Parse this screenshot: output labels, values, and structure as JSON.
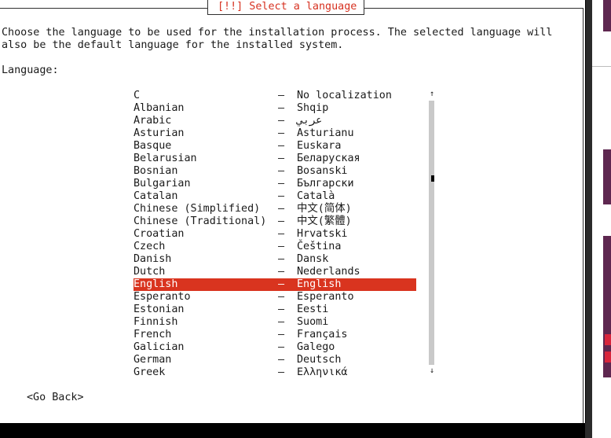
{
  "dialog": {
    "title": "[!!] Select a language",
    "description_line1": "Choose the language to be used for the installation process. The selected language will",
    "description_line2": "also be the default language for the installed system.",
    "list_label": "Language:",
    "go_back_label": "<Go Back>"
  },
  "languages": [
    {
      "name": "C",
      "native": "No localization"
    },
    {
      "name": "Albanian",
      "native": "Shqip"
    },
    {
      "name": "Arabic",
      "native": "عربي"
    },
    {
      "name": "Asturian",
      "native": "Asturianu"
    },
    {
      "name": "Basque",
      "native": "Euskara"
    },
    {
      "name": "Belarusian",
      "native": "Беларуская"
    },
    {
      "name": "Bosnian",
      "native": "Bosanski"
    },
    {
      "name": "Bulgarian",
      "native": "Български"
    },
    {
      "name": "Catalan",
      "native": "Català"
    },
    {
      "name": "Chinese (Simplified)",
      "native": "中文(简体)"
    },
    {
      "name": "Chinese (Traditional)",
      "native": "中文(繁體)"
    },
    {
      "name": "Croatian",
      "native": "Hrvatski"
    },
    {
      "name": "Czech",
      "native": "Čeština"
    },
    {
      "name": "Danish",
      "native": "Dansk"
    },
    {
      "name": "Dutch",
      "native": "Nederlands"
    },
    {
      "name": "English",
      "native": "English",
      "selected": true
    },
    {
      "name": "Esperanto",
      "native": "Esperanto"
    },
    {
      "name": "Estonian",
      "native": "Eesti"
    },
    {
      "name": "Finnish",
      "native": "Suomi"
    },
    {
      "name": "French",
      "native": "Français"
    },
    {
      "name": "Galician",
      "native": "Galego"
    },
    {
      "name": "German",
      "native": "Deutsch"
    },
    {
      "name": "Greek",
      "native": "Ελληνικά"
    }
  ],
  "separator": "–",
  "scrollbar": {
    "up_arrow": "↑",
    "down_arrow": "↓",
    "position_fraction": 0.29
  },
  "colors": {
    "accent": "#d9341f",
    "background": "#ffffff",
    "text": "#1a1a1a"
  }
}
